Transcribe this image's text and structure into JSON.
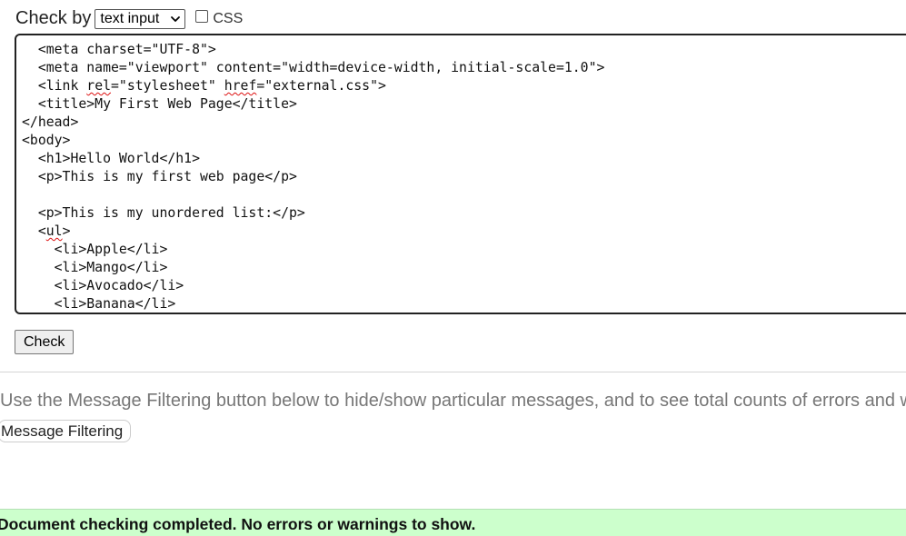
{
  "check_by": {
    "label": "Check by",
    "selected": "text input",
    "css_label": "CSS",
    "css_checked": false
  },
  "code_lines": [
    {
      "segments": [
        {
          "t": "  <meta charset=\"UTF-8\">"
        }
      ]
    },
    {
      "segments": [
        {
          "t": "  <meta name=\"viewport\" content=\"width=device-width, initial-scale=1.0\">"
        }
      ]
    },
    {
      "segments": [
        {
          "t": "  <link "
        },
        {
          "t": "rel",
          "spell": true
        },
        {
          "t": "=\"stylesheet\" "
        },
        {
          "t": "href",
          "spell": true
        },
        {
          "t": "=\"external.css\">"
        }
      ]
    },
    {
      "segments": [
        {
          "t": "  <title>My First Web Page</title>"
        }
      ]
    },
    {
      "segments": [
        {
          "t": "</head>"
        }
      ]
    },
    {
      "segments": [
        {
          "t": "<body>"
        }
      ]
    },
    {
      "segments": [
        {
          "t": "  <h1>Hello World</h1>"
        }
      ]
    },
    {
      "segments": [
        {
          "t": "  <p>This is my first web page</p>"
        }
      ]
    },
    {
      "segments": [
        {
          "t": ""
        }
      ]
    },
    {
      "segments": [
        {
          "t": "  <p>This is my unordered list:</p>"
        }
      ]
    },
    {
      "segments": [
        {
          "t": "  <"
        },
        {
          "t": "ul",
          "spell": true
        },
        {
          "t": ">"
        }
      ]
    },
    {
      "segments": [
        {
          "t": "    <li>Apple</li>"
        }
      ]
    },
    {
      "segments": [
        {
          "t": "    <li>Mango</li>"
        }
      ]
    },
    {
      "segments": [
        {
          "t": "    <li>Avocado</li>"
        }
      ]
    },
    {
      "segments": [
        {
          "t": "    <li>Banana</li>"
        }
      ]
    }
  ],
  "check_button": "Check",
  "filter_info": "Use the Message Filtering button below to hide/show particular messages, and to see total counts of errors and w",
  "filter_button": "Message Filtering",
  "result_message": "Document checking completed. No errors or warnings to show."
}
